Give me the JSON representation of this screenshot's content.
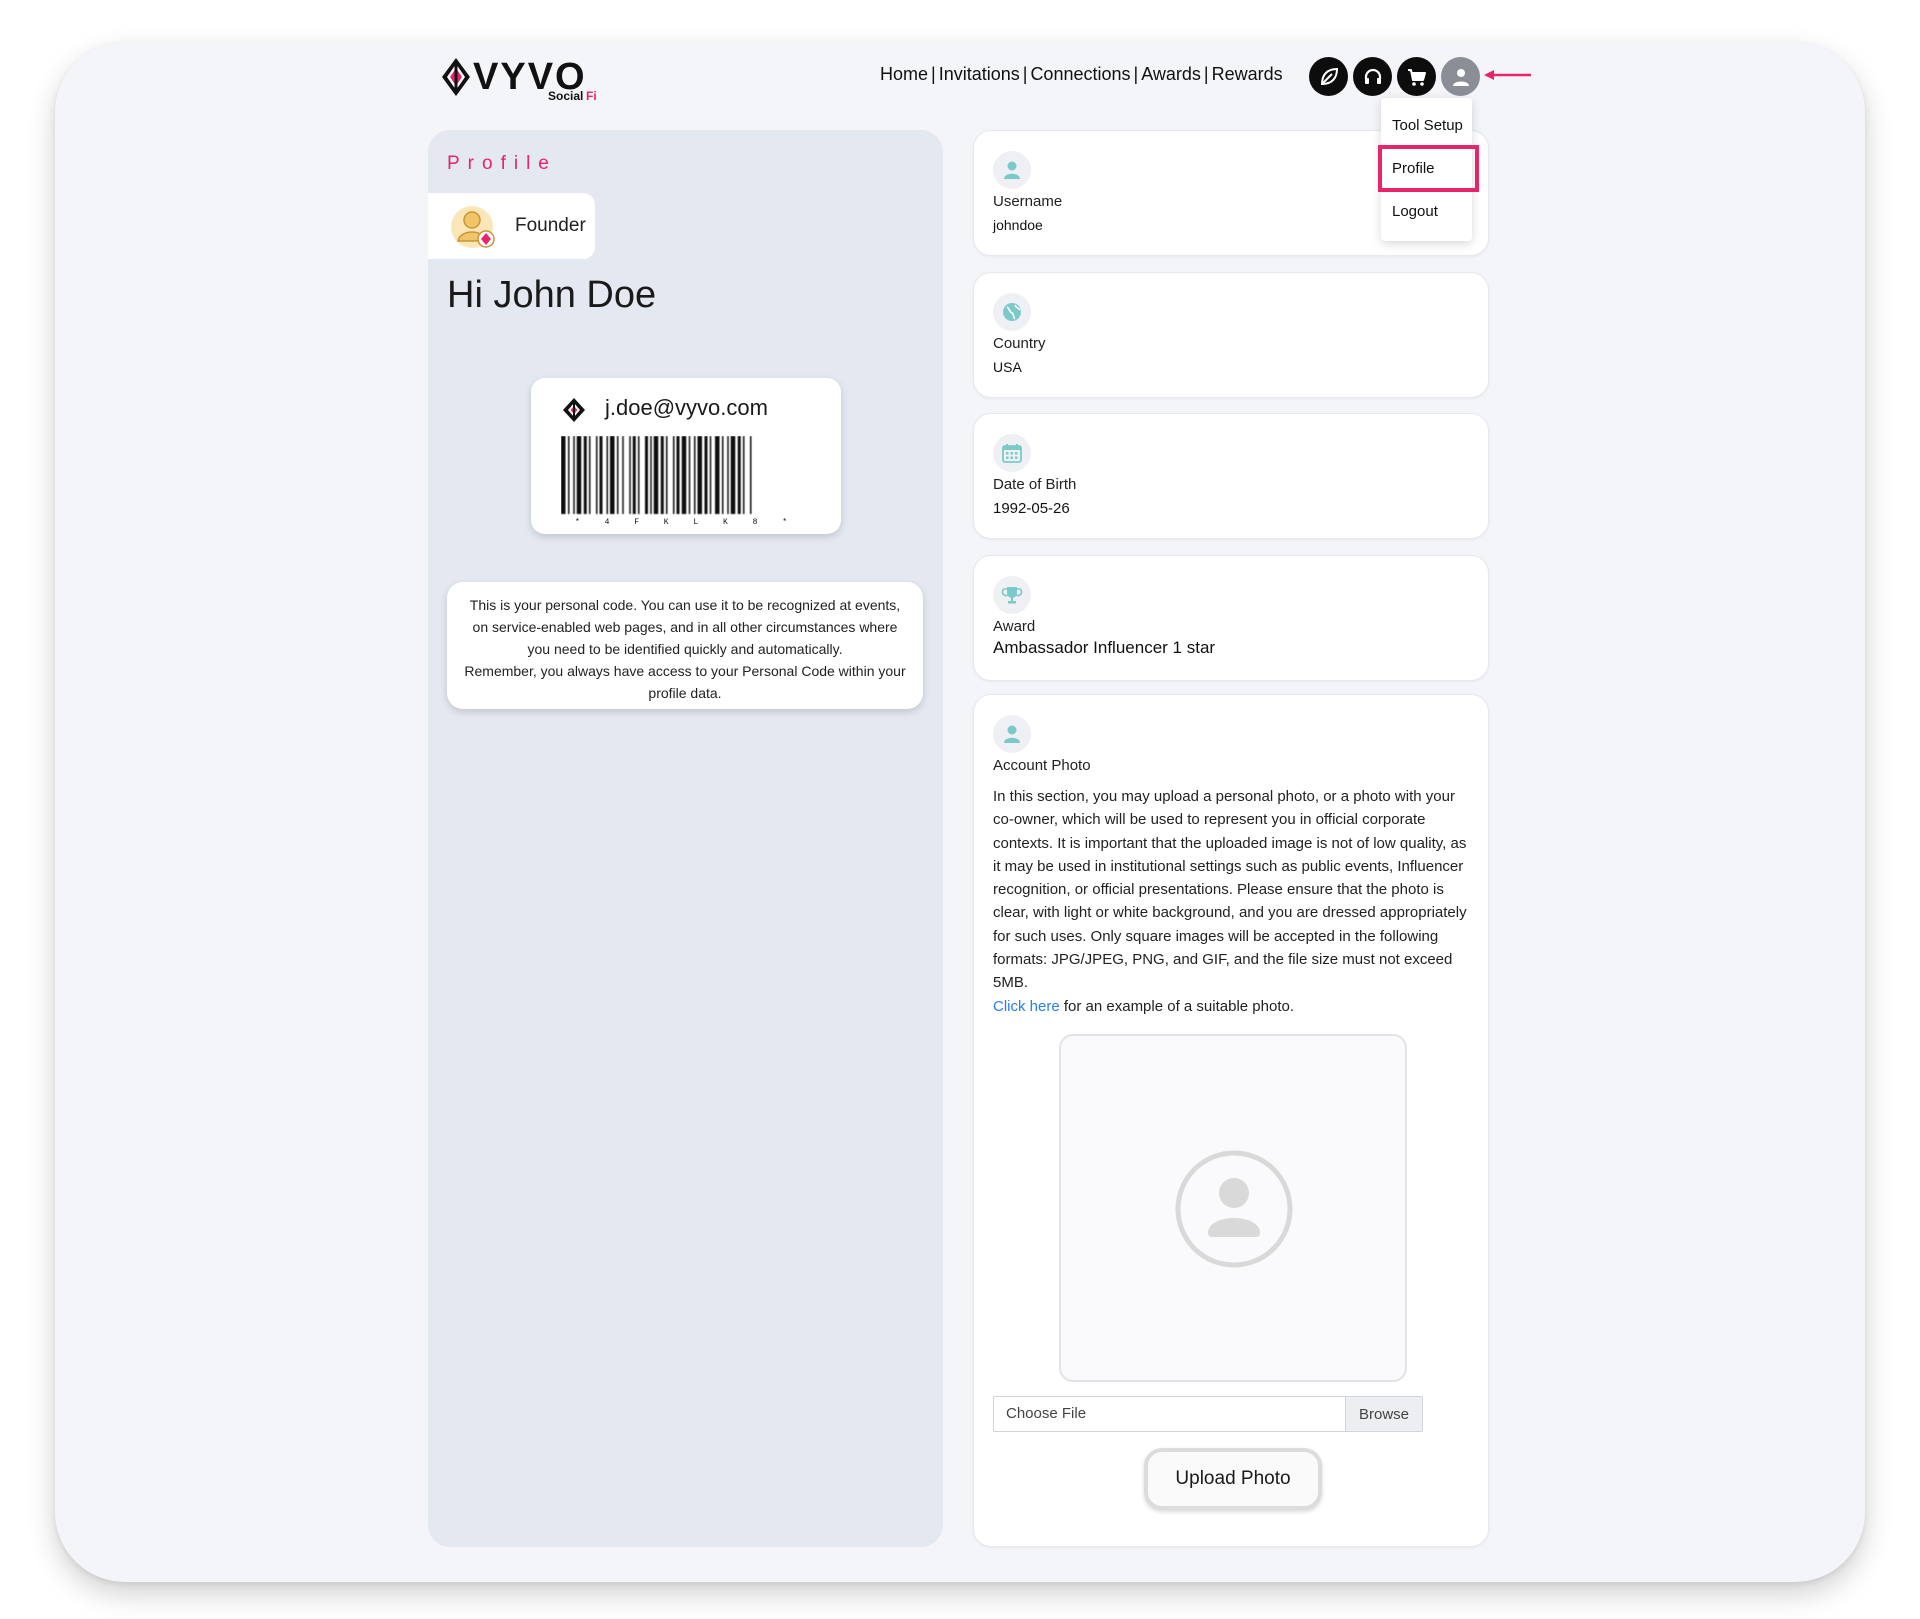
{
  "brand": {
    "name": "VYVO",
    "sub": "SocialFi"
  },
  "nav": {
    "items": [
      "Home",
      "Invitations",
      "Connections",
      "Awards",
      "Rewards"
    ],
    "icons": [
      "leaf-icon",
      "headset-icon",
      "cart-icon",
      "user-icon"
    ]
  },
  "dropdown": {
    "items": [
      "Tool Setup",
      "Profile",
      "Logout"
    ],
    "highlighted": "Profile"
  },
  "left": {
    "heading": "Profile",
    "role": "Founder",
    "greeting": "Hi John Doe",
    "code_email": "j.doe@vyvo.com",
    "barcode_text": "* 4 F K L K 8 *",
    "info_line1": "This is your personal code. You can use it to be recognized at events, on service-enabled web pages, and in all other circumstances where you need to be identified quickly and automatically.",
    "info_line2": "Remember, you always have access to your Personal Code within your profile data."
  },
  "fields": {
    "username": {
      "label": "Username",
      "value": "johndoe"
    },
    "country": {
      "label": "Country",
      "value": "USA"
    },
    "dob": {
      "label": "Date of Birth",
      "value": "1992-05-26"
    },
    "award": {
      "label": "Award",
      "value": "Ambassador Influencer 1 star"
    }
  },
  "photo": {
    "label": "Account Photo",
    "description": "In this section, you may upload a personal photo, or a photo with your co-owner, which will be used to represent you in official corporate contexts. It is important that the uploaded image is not of low quality, as it may be used in institutional settings such as public events, Influencer recognition, or official presentations. Please ensure that the photo is clear, with light or white background, and you are dressed appropriately for such uses. Only square images will be accepted in the following formats: JPG/JPEG, PNG, and GIF, and the file size must not exceed 5MB.",
    "link": "Click here",
    "link_suffix": " for an example of a suitable photo.",
    "file_placeholder": "Choose File",
    "browse": "Browse",
    "upload": "Upload Photo"
  },
  "colors": {
    "accent": "#e8246b",
    "link": "#2b7de9",
    "icon_teal": "#7cc9c9"
  }
}
